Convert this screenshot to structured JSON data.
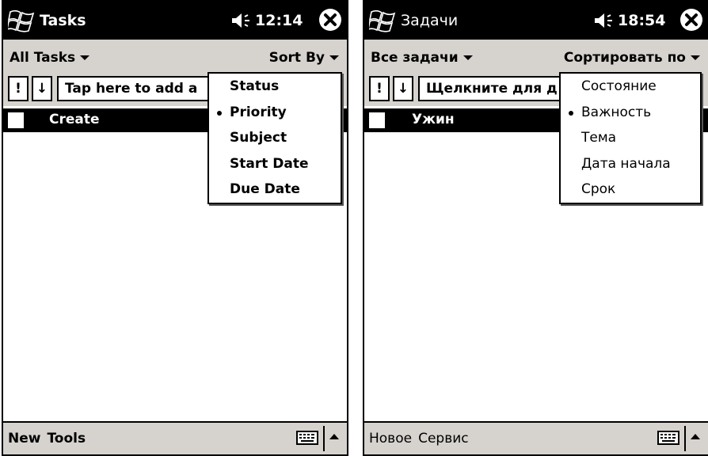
{
  "left": {
    "title": "Tasks",
    "time": "12:14",
    "menu_left": "All Tasks",
    "menu_right": "Sort By",
    "priority_btn": "!",
    "sort_btn": "↓",
    "entry_placeholder": "Tap here to add a",
    "task": "Create",
    "dropdown": [
      "Status",
      "Priority",
      "Subject",
      "Start Date",
      "Due Date"
    ],
    "selected": "Priority",
    "bottom_menu": [
      "New",
      "Tools"
    ]
  },
  "right": {
    "title": "Задачи",
    "time": "18:54",
    "menu_left": "Все задачи",
    "menu_right": "Сортировать по",
    "priority_btn": "!",
    "sort_btn": "↓",
    "entry_placeholder": "Щелкните для д",
    "task": "Ужин",
    "dropdown": [
      "Состояние",
      "Важность",
      "Тема",
      "Дата начала",
      "Срок"
    ],
    "selected": "Важность",
    "bottom_menu": [
      "Новое",
      "Сервис"
    ]
  },
  "colors": {
    "titlebar": "#000000",
    "bars": "#d6d3ce",
    "selection": "#000000"
  },
  "icons": [
    "windows-start-icon",
    "speaker-icon",
    "close-icon",
    "chevron-down-icon",
    "keyboard-icon",
    "sip-up-arrow-icon"
  ]
}
